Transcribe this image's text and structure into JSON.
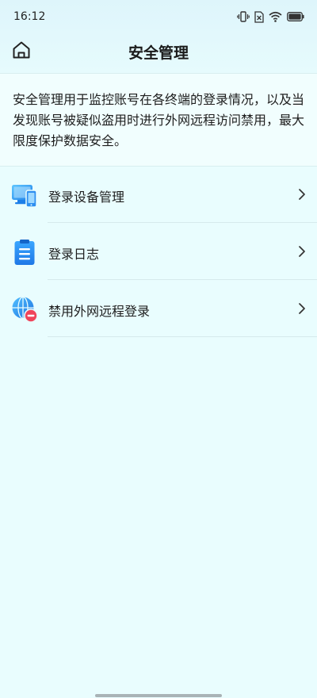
{
  "status_bar": {
    "time": "16:12",
    "icons": [
      "vibrate-icon",
      "no-sim-icon",
      "wifi-icon",
      "battery-icon"
    ]
  },
  "header": {
    "title": "安全管理",
    "home_icon": "home-icon"
  },
  "intro": {
    "text": "安全管理用于监控账号在各终端的登录情况，以及当发现账号被疑似盗用时进行外网远程访问禁用，最大限度保护数据安全。"
  },
  "menu": {
    "items": [
      {
        "label": "登录设备管理",
        "icon": "devices-icon"
      },
      {
        "label": "登录日志",
        "icon": "clipboard-icon"
      },
      {
        "label": "禁用外网远程登录",
        "icon": "globe-block-icon"
      }
    ]
  },
  "colors": {
    "background": "#e9fdfe",
    "accent_blue": "#2f8ff0",
    "block_red": "#f0445a"
  }
}
